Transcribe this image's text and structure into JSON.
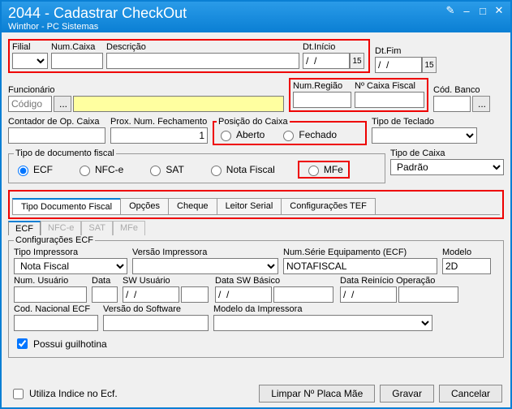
{
  "window": {
    "title": "2044 - Cadastrar CheckOut",
    "subtitle": "Winthor - PC Sistemas"
  },
  "ctrl": {
    "edit": "✎",
    "min": "–",
    "max": "□",
    "close": "✕"
  },
  "top": {
    "filial": "Filial",
    "numcaixa": "Num.Caixa",
    "descricao": "Descrição",
    "dtinicio": "Dt.Início",
    "dtfim": "Dt.Fim",
    "dateval": "/  /",
    "dateico": "15"
  },
  "func": {
    "label": "Funcionário",
    "placeholder": "Código",
    "ellipsis": "..."
  },
  "reg": {
    "numregiao": "Num.Região",
    "numcaixafiscal": "Nº Caixa Fiscal",
    "codbanco": "Cód. Banco"
  },
  "mid": {
    "contador": "Contador de Op. Caixa",
    "proxnum": "Prox. Num. Fechamento",
    "proxnumval": "1",
    "posicao": "Posição do Caixa",
    "aberto": "Aberto",
    "fechado": "Fechado",
    "tipoteclado": "Tipo de Teclado"
  },
  "docfiscal": {
    "label": "Tipo de documento fiscal",
    "ecf": "ECF",
    "nfce": "NFC-e",
    "sat": "SAT",
    "nota": "Nota Fiscal",
    "mfe": "MFe",
    "tipocaixa": "Tipo de Caixa",
    "tipocaixaval": "Padrão"
  },
  "tabs": {
    "t1": "Tipo Documento Fiscal",
    "t2": "Opções",
    "t3": "Cheque",
    "t4": "Leitor Serial",
    "t5": "Configurações TEF"
  },
  "subtabs": {
    "s1": "ECF",
    "s2": "NFC-e",
    "s3": "SAT",
    "s4": "MFe"
  },
  "ecf": {
    "legend": "Configurações ECF",
    "tipoimp": "Tipo Impressora",
    "tipoimpval": "Nota Fiscal",
    "verimp": "Versão Impressora",
    "numserie": "Num.Série Equipamento (ECF)",
    "numserieval": "NOTAFISCAL",
    "modelo": "Modelo",
    "modeloval": "2D",
    "numusuario": "Num. Usuário",
    "data": "Data",
    "swusuario": "SW Usuário",
    "dataswbasico": "Data SW Básico",
    "datareinicio": "Data Reinício Operação",
    "datev": "/  /",
    "codnac": "Cod. Nacional ECF",
    "versoft": "Versão do Software",
    "modimp": "Modelo da Impressora",
    "guilhotina": "Possui guilhotina"
  },
  "footer": {
    "utilizaindice": "Utiliza Indice no Ecf.",
    "limpar": "Limpar Nº Placa Mãe",
    "gravar": "Gravar",
    "cancelar": "Cancelar"
  }
}
